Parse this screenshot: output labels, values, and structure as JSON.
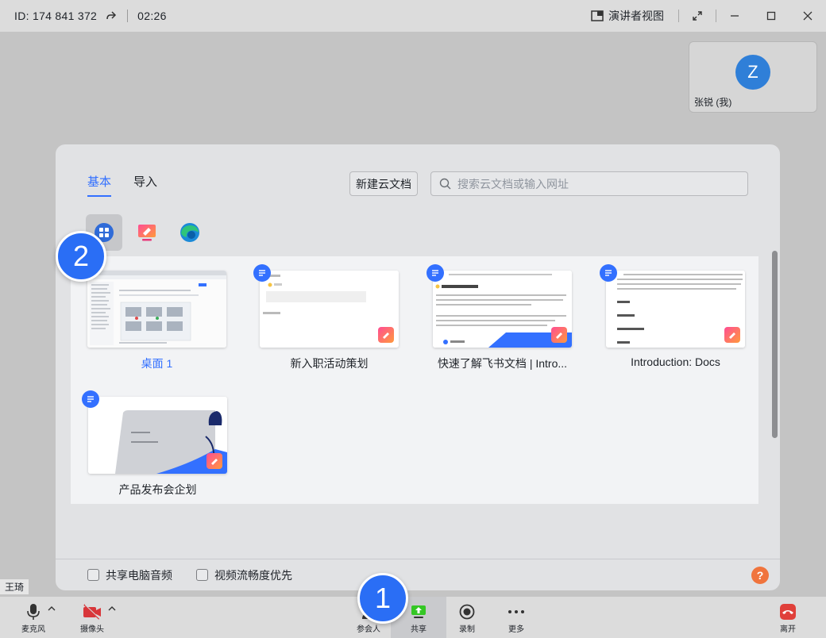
{
  "titlebar": {
    "meeting_id": "ID:  174 841 372",
    "timer": "02:26",
    "presenter_view": "演讲者视图"
  },
  "self_tile": {
    "avatar_letter": "Z",
    "name": "张锐 (我)"
  },
  "dialog": {
    "tabs": [
      {
        "label": "基本"
      },
      {
        "label": "导入"
      }
    ],
    "new_doc_button": "新建云文档",
    "search_placeholder": "搜索云文档或输入网址",
    "cards": [
      {
        "label": "桌面 1"
      },
      {
        "label": "新入职活动策划"
      },
      {
        "label": "快速了解飞书文档 | Intro..."
      },
      {
        "label": "Introduction: Docs"
      },
      {
        "label": "产品发布会企划"
      }
    ],
    "footer": {
      "share_audio": "共享电脑音频",
      "video_smooth": "视频流畅度优先",
      "help": "?"
    }
  },
  "markers": {
    "one": "1",
    "two": "2"
  },
  "participant_name": "王琦",
  "toolbar": {
    "mic": "麦克风",
    "camera": "摄像头",
    "participants": "参会人",
    "share": "共享",
    "record": "录制",
    "more": "更多",
    "leave": "离开"
  },
  "colors": {
    "accent": "#3370ff",
    "marker": "#2a6ef5",
    "leave": "#e0403a",
    "share_green": "#34c724"
  }
}
